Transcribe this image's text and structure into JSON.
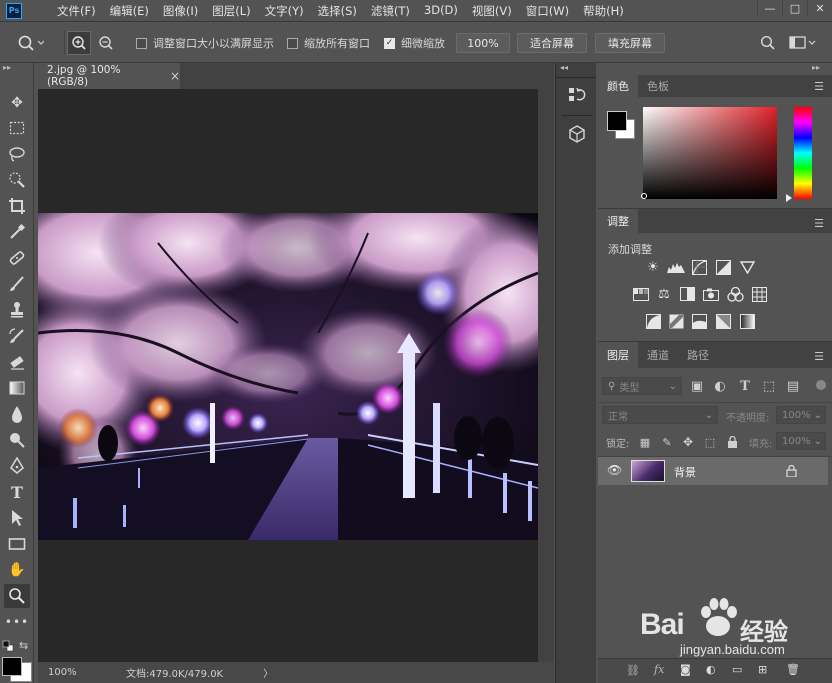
{
  "app": {
    "logo": "Ps"
  },
  "menubar": {
    "items": [
      "文件(F)",
      "编辑(E)",
      "图像(I)",
      "图层(L)",
      "文字(Y)",
      "选择(S)",
      "滤镜(T)",
      "3D(D)",
      "视图(V)",
      "窗口(W)",
      "帮助(H)"
    ],
    "window_buttons": [
      "—",
      "□",
      "✕"
    ]
  },
  "options": {
    "resize_windows_label": "调整窗口大小以满屏显示",
    "zoom_all_label": "缩放所有窗口",
    "scrubby_zoom_label": "细微缩放",
    "scrubby_zoom_checked": true,
    "zoom_value": "100%",
    "fit_screen_label": "适合屏幕",
    "fill_screen_label": "填充屏幕"
  },
  "document": {
    "tab_title": "2.jpg @ 100%(RGB/8)",
    "tab_close": "×",
    "zoom": "100%",
    "doc_info": "文档:479.0K/479.0K",
    "status_arrow": "〉"
  },
  "color_panel": {
    "tabs": [
      "颜色",
      "色板"
    ],
    "foreground": "#000000",
    "background": "#ffffff"
  },
  "adjustments_panel": {
    "tab": "调整",
    "add_label": "添加调整"
  },
  "layers_panel": {
    "tabs": [
      "图层",
      "通道",
      "路径"
    ],
    "filter_kind": "类型",
    "blend_mode": "正常",
    "opacity_label": "不透明度:",
    "opacity_value": "100%",
    "lock_label": "锁定:",
    "fill_label": "填充:",
    "fill_value": "100%",
    "layers": [
      {
        "name": "背景",
        "locked": true,
        "visible": true
      }
    ]
  },
  "watermark": {
    "brand": "Bai",
    "brand_suffix": "经验",
    "url": "jingyan.baidu.com"
  },
  "colors": {
    "accent": "#31a8ff",
    "panel_bg": "#535353",
    "canvas_bg": "#282828"
  }
}
